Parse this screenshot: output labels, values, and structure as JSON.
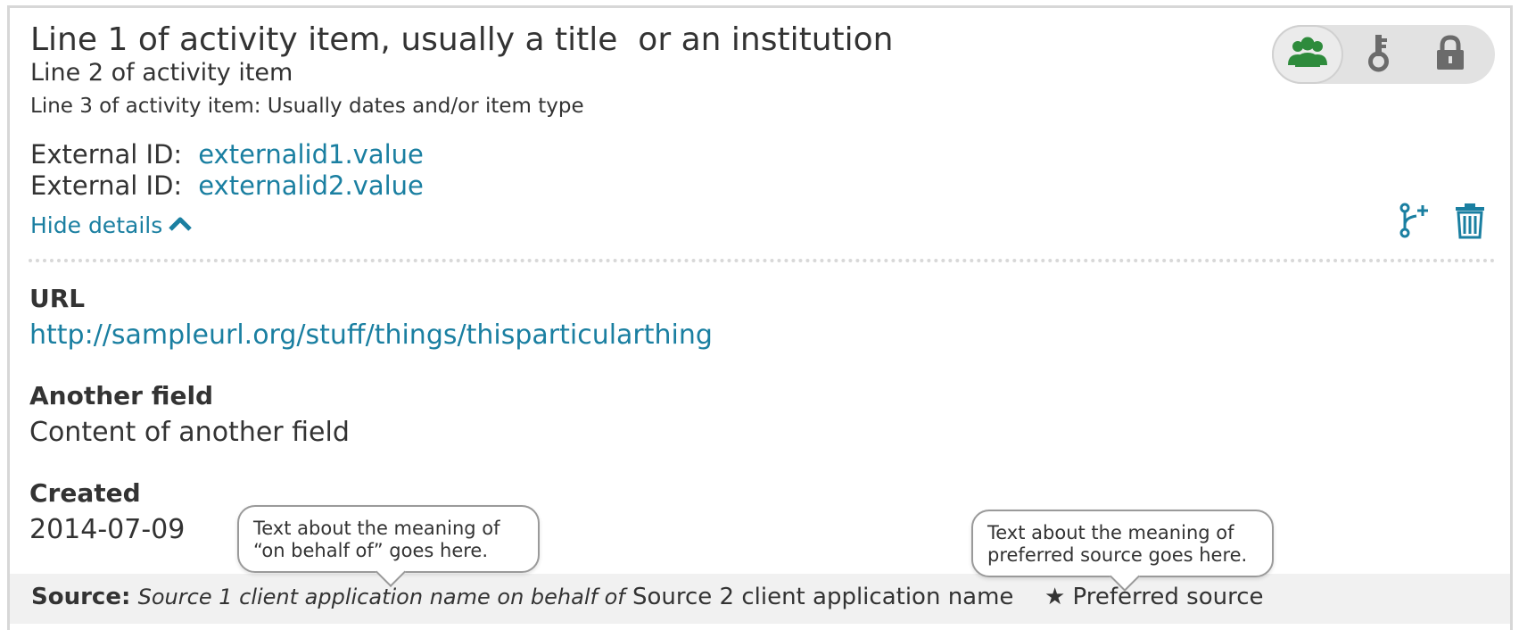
{
  "activity": {
    "line1": "Line 1 of activity item, usually a title  or an institution",
    "line2": "Line 2 of activity item",
    "line3": "Line 3 of activity item: Usually dates and/or item type"
  },
  "external_ids": [
    {
      "label": "External ID:",
      "value": "externalid1.value"
    },
    {
      "label": "External ID:",
      "value": "externalid2.value"
    }
  ],
  "hide_details_label": "Hide details",
  "visibility": {
    "options": [
      {
        "icon": "users-icon",
        "active": true
      },
      {
        "icon": "key-icon",
        "active": false
      },
      {
        "icon": "lock-icon",
        "active": false
      }
    ]
  },
  "actions": {
    "icons": [
      "branch-add-icon",
      "trash-icon"
    ]
  },
  "fields": [
    {
      "label": "URL",
      "value": "http://sampleurl.org/stuff/things/thisparticularthing"
    },
    {
      "label": "Another field",
      "value": "Content of another field"
    },
    {
      "label": "Created",
      "value": "2014-07-09"
    }
  ],
  "source": {
    "label": "Source:",
    "on_behalf": "Source 1 client application name on behalf of",
    "client2": "Source 2 client application name",
    "star": "★",
    "preferred": "Preferred source"
  },
  "tooltips": {
    "on_behalf": [
      "Text about the meaning of",
      "“on behalf of” goes here."
    ],
    "preferred": [
      "Text about the meaning of",
      "preferred source goes here."
    ]
  },
  "colors": {
    "link": "#1a7fa1",
    "active_icon": "#2e8b3c",
    "inactive_icon": "#6b6b6b",
    "source_bar": "#f1f1f1"
  }
}
